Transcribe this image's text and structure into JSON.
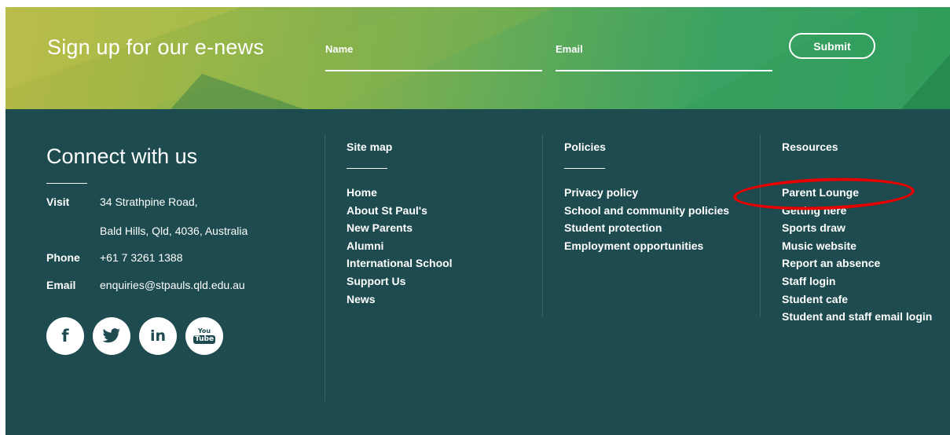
{
  "enews": {
    "title": "Sign up for our e-news",
    "name_placeholder": "Name",
    "email_placeholder": "Email",
    "submit_label": "Submit"
  },
  "connect": {
    "title": "Connect with us",
    "visit_label": "Visit",
    "address_line1": "34 Strathpine Road,",
    "address_line2": "Bald Hills, Qld, 4036, Australia",
    "phone_label": "Phone",
    "phone_value": "+61 7 3261 1388",
    "email_label": "Email",
    "email_value": "enquiries@stpauls.qld.edu.au",
    "social": [
      {
        "icon": "facebook-icon",
        "glyph": "f"
      },
      {
        "icon": "twitter-icon",
        "glyph": "bird"
      },
      {
        "icon": "linkedin-icon",
        "glyph": "in"
      },
      {
        "icon": "youtube-icon",
        "glyph_top": "You",
        "glyph_bottom": "Tube"
      }
    ]
  },
  "sitemap": {
    "heading": "Site map",
    "items": [
      "Home",
      "About St Paul's",
      "New Parents",
      "Alumni",
      "International School",
      "Support Us",
      "News"
    ]
  },
  "policies": {
    "heading": "Policies",
    "items": [
      "Privacy policy",
      "School and community policies",
      "Student protection",
      "Employment opportunities"
    ]
  },
  "resources": {
    "heading": "Resources",
    "items": [
      "Parent Lounge",
      "Getting here",
      "Sports draw",
      "Music website",
      "Report an absence",
      "Staff login",
      "Student cafe",
      "Student and staff email login"
    ]
  },
  "colors": {
    "footer_bg": "#1d4b4f",
    "banner_left": "#b4b845",
    "banner_right": "#35a05f",
    "annotation": "#e60000"
  }
}
